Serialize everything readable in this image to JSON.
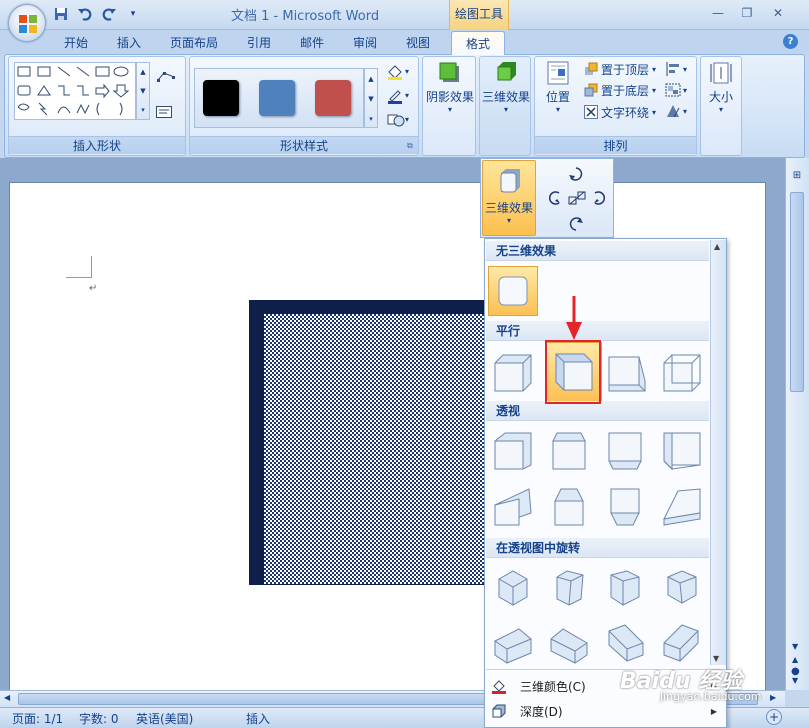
{
  "window": {
    "title": "文档 1 - Microsoft Word",
    "context_tab_group": "绘图工具"
  },
  "tabs": [
    {
      "label": "开始"
    },
    {
      "label": "插入"
    },
    {
      "label": "页面布局"
    },
    {
      "label": "引用"
    },
    {
      "label": "邮件"
    },
    {
      "label": "审阅"
    },
    {
      "label": "视图"
    },
    {
      "label": "格式"
    }
  ],
  "ribbon": {
    "insert_shapes": {
      "group_label": "插入形状"
    },
    "shape_styles": {
      "group_label": "形状样式",
      "swatches": [
        "#000000",
        "#4f81bd",
        "#c0504d"
      ]
    },
    "shadow_effects": {
      "label": "阴影效果"
    },
    "three_d_effects": {
      "label": "三维效果"
    },
    "arrange": {
      "group_label": "排列",
      "position_label": "位置",
      "bring_front": "置于顶层",
      "send_back": "置于底层",
      "text_wrap": "文字环绕"
    },
    "size": {
      "label": "大小"
    }
  },
  "dropdown": {
    "button_label": "三维效果",
    "sections": {
      "none": "无三维效果",
      "parallel": "平行",
      "perspective": "透视",
      "rotate": "在透视图中旋转"
    },
    "menu_items": [
      {
        "label": "三维颜色(C)",
        "icon": "fill-color-icon"
      },
      {
        "label": "深度(D)",
        "icon": "depth-icon"
      }
    ]
  },
  "status": {
    "page": "页面: 1/1",
    "words": "字数: 0",
    "language": "英语(美国)",
    "mode": "插入"
  },
  "watermark": {
    "brand": "Baidu 经验",
    "url": "jingyan.baidu.com"
  }
}
